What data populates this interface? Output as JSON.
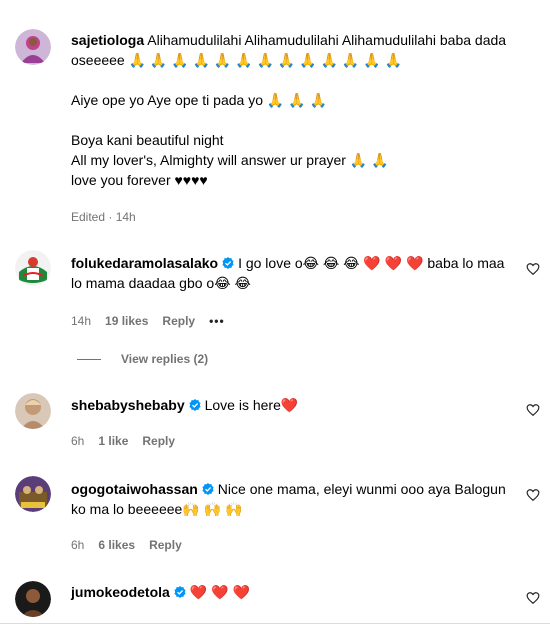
{
  "comments": [
    {
      "username": "sajetiologa",
      "lines": [
        "Alihamudulilahi Alihamudulilahi Alihamudulilahi baba dada oseeeee 🙏 🙏 🙏 🙏 🙏 🙏 🙏 🙏 🙏 🙏 🙏 🙏 🙏",
        "Aiye ope yo Aye ope ti pada yo 🙏 🙏 🙏",
        "Boya kani beautiful night",
        "All my lover's, Almighty will answer ur prayer 🙏 🙏",
        "love you forever ♥♥♥♥"
      ],
      "meta": "Edited · 14h"
    },
    {
      "username": "folukedaramolasalako",
      "text": "I go love o😂 😂 😂 ❤️ ❤️ ❤️ baba lo maa lo mama daadaa gbo o😂 😂",
      "time": "14h",
      "likes": "19 likes",
      "reply": "Reply",
      "more": "•••"
    },
    {
      "username": "shebabyshebaby",
      "text": "Love is here❤️",
      "time": "6h",
      "likes": "1 like",
      "reply": "Reply"
    },
    {
      "username": "ogogotaiwohassan",
      "text": "Nice one mama, eleyi wunmi ooo aya Balogun ko ma lo beeeeee🙌 🙌 🙌",
      "time": "6h",
      "likes": "6 likes",
      "reply": "Reply"
    },
    {
      "username": "jumokeodetola",
      "text": "❤️ ❤️ ❤️"
    }
  ],
  "view_replies": "View replies (2)",
  "colors": {
    "verified": "#0095f6",
    "muted": "#737373",
    "heart": "#e0142b"
  },
  "icons": [
    "verified-badge-icon",
    "heart-outline-icon"
  ]
}
